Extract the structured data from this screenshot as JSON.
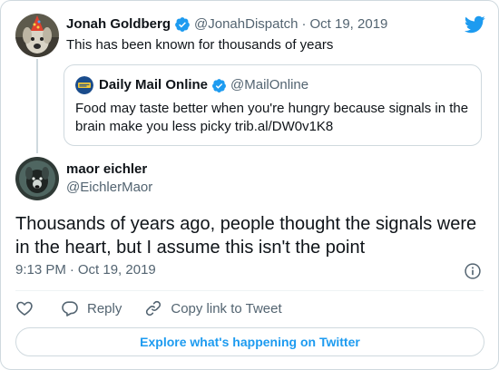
{
  "colors": {
    "accent": "#1d9bf0",
    "text": "#0f1419",
    "muted": "#536471",
    "border": "#cfd9de"
  },
  "brand": {
    "icon": "twitter-bird-icon"
  },
  "parent_tweet": {
    "author_name": "Jonah Goldberg",
    "author_handle": "@JonahDispatch",
    "separator": "·",
    "date": "Oct 19, 2019",
    "text": "This has been known for thousands of years",
    "avatar_icon": "dog-party-hat-avatar"
  },
  "quoted_tweet": {
    "author_name": "Daily Mail Online",
    "author_handle": "@MailOnline",
    "text": "Food may taste better when you're hungry because signals in the brain make you less picky trib.al/DW0v1K8",
    "avatar_icon": "daily-mail-logo-avatar"
  },
  "main_tweet": {
    "author_name": "maor eichler",
    "author_handle": "@EichlerMaor",
    "text": "Thousands of years ago, people thought the signals were in the heart, but I assume this isn't the point",
    "time": "9:13 PM",
    "separator": "·",
    "date": "Oct 19, 2019",
    "avatar_icon": "dark-dog-avatar"
  },
  "actions": {
    "like_icon": "heart-icon",
    "reply_label": "Reply",
    "copy_link_label": "Copy link to Tweet"
  },
  "explore_label": "Explore what's happening on Twitter"
}
